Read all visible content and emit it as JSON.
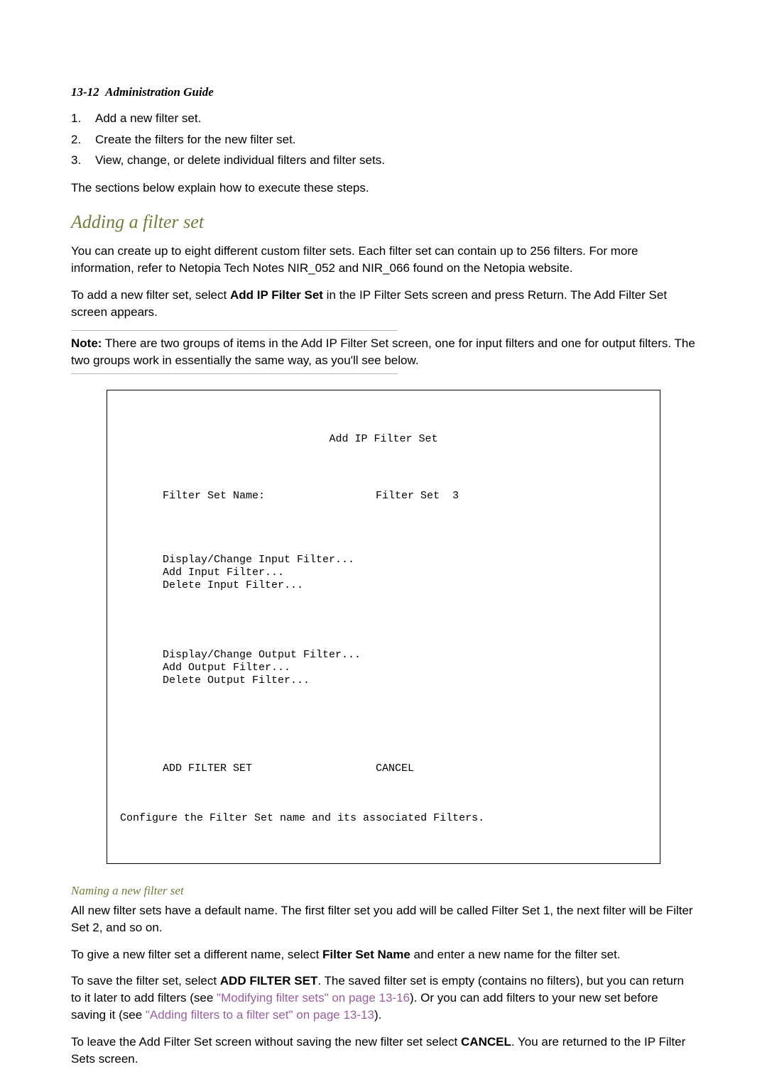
{
  "header": {
    "page_ref": "13-12",
    "title": "Administration Guide"
  },
  "ordered_steps": {
    "items": [
      {
        "num": "1.",
        "text": "Add a new filter set."
      },
      {
        "num": "2.",
        "text": "Create the filters for the new filter set."
      },
      {
        "num": "3.",
        "text": "View, change, or delete individual filters and filter sets."
      }
    ]
  },
  "intro_follow": "The sections below explain how to execute these steps.",
  "section1": {
    "title": "Adding a filter set",
    "p1": "You can create up to eight different custom filter sets. Each filter set can contain up to 256 filters. For more information, refer to Netopia Tech Notes NIR_052 and NIR_066 found on the Netopia website.",
    "p2_pre": "To add a new filter set, select ",
    "p2_bold": "Add IP Filter Set",
    "p2_post": " in the IP Filter Sets screen and press Return. The Add Filter Set screen appears.",
    "note_label": "Note:",
    "note_text": " There are two groups of items in the Add IP Filter Set screen, one for input filters and one for output filters. The two groups work in essentially the same way, as you'll see below."
  },
  "terminal": {
    "title": "Add IP Filter Set",
    "name_label": "Filter Set Name:",
    "name_value": "Filter Set  3",
    "input_group": {
      "line1": "Display/Change Input Filter...",
      "line2": "Add Input Filter...",
      "line3": "Delete Input Filter..."
    },
    "output_group": {
      "line1": "Display/Change Output Filter...",
      "line2": "Add Output Filter...",
      "line3": "Delete Output Filter..."
    },
    "action_add": "ADD FILTER SET",
    "action_cancel": "CANCEL",
    "status": "Configure the Filter Set name and its associated Filters."
  },
  "section2": {
    "title": "Naming a new filter set",
    "p1": "All new filter sets have a default name. The first filter set you add will be called Filter Set 1, the next filter will be Filter Set 2, and so on.",
    "p2_pre": "To give a new filter set a different name, select ",
    "p2_bold": "Filter Set Name",
    "p2_post": " and enter a new name for the filter set.",
    "p3_pre": "To save the filter set, select ",
    "p3_bold": "ADD FILTER SET",
    "p3_mid": ". The saved filter set is empty (contains no filters), but you can return to it later to add filters (see ",
    "p3_xref1": "\"Modifying filter sets\" on page 13-16",
    "p3_mid2": "). Or you can add filters to your new set before saving it (see ",
    "p3_xref2": "\"Adding filters to a filter set\" on page 13-13",
    "p3_post": ").",
    "p4_pre": "To leave the Add Filter Set screen without saving the new filter set select ",
    "p4_bold": "CANCEL",
    "p4_post": ". You are returned to the IP Filter Sets screen."
  }
}
